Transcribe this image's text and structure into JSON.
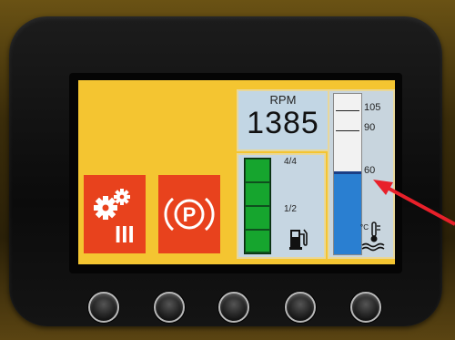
{
  "rpm": {
    "label": "RPM",
    "value": "1385"
  },
  "fuel": {
    "level_fraction": 1.0,
    "mark_full": "4/4",
    "mark_half": "1/2",
    "icon": "fuel-pump-icon"
  },
  "coolant_temp": {
    "unit_icon": "coolant-temperature-icon",
    "unit": "°C",
    "scale": [
      "105",
      "90",
      "60"
    ],
    "current_value": 60
  },
  "buttons": [
    {
      "icon": "gears-icon",
      "label": "III"
    },
    {
      "icon": "parking-brake-icon",
      "label": "P"
    }
  ],
  "hardware_buttons": 5,
  "colors": {
    "screen_background": "#f4c531",
    "button_red": "#e8421d",
    "fuel_green": "#16a52e",
    "temp_blue": "#2a7fd1",
    "annotation_arrow": "#e8202a"
  }
}
